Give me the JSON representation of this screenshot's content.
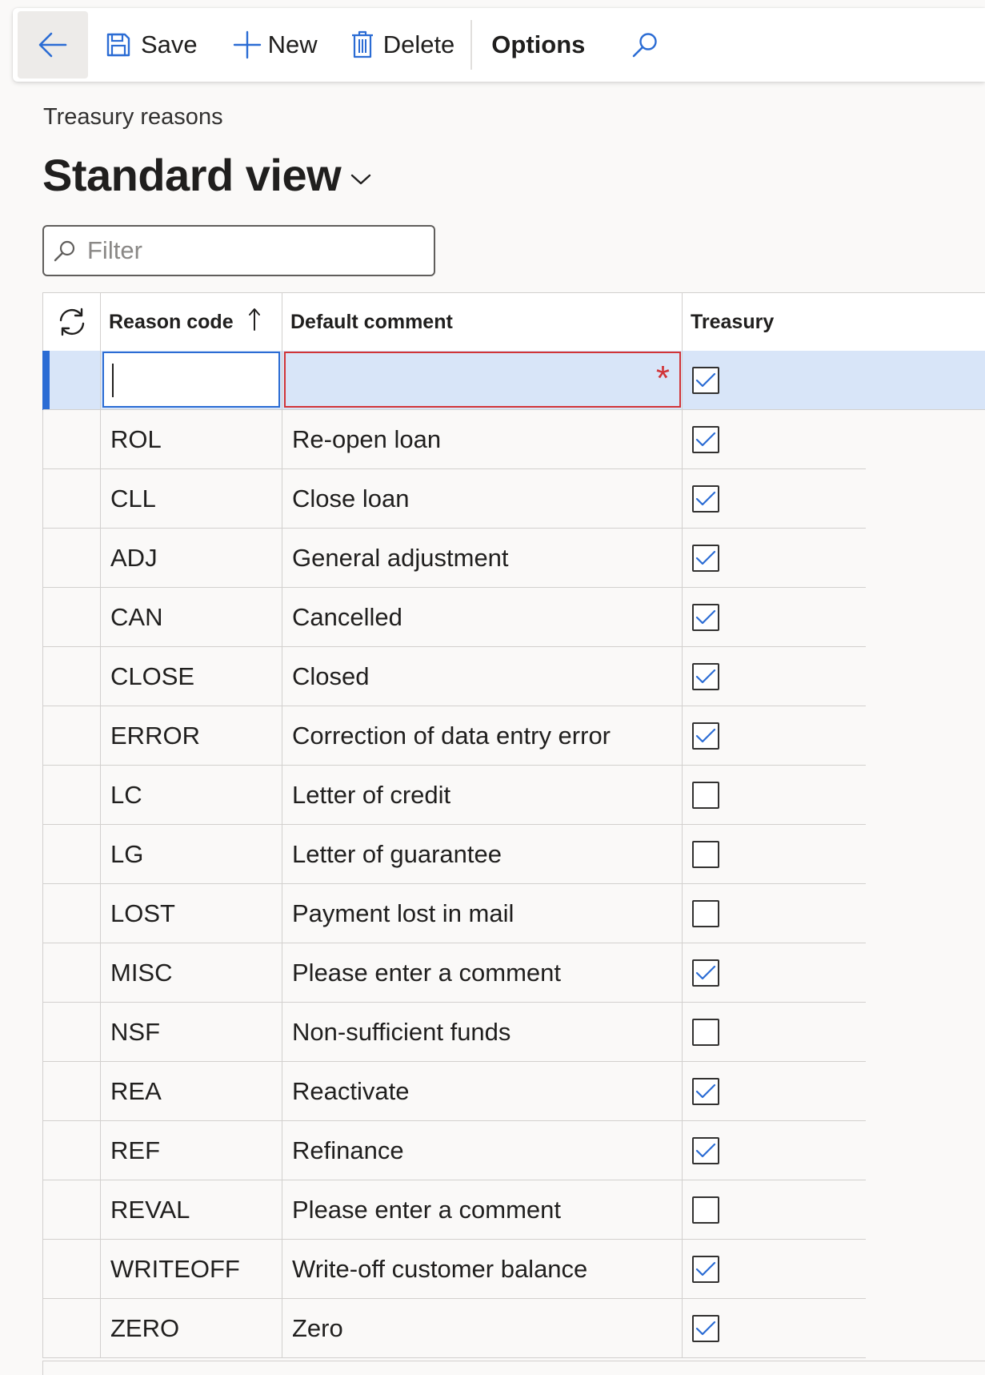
{
  "toolbar": {
    "save_label": "Save",
    "new_label": "New",
    "delete_label": "Delete",
    "options_label": "Options"
  },
  "page": {
    "caption": "Treasury reasons",
    "view_title": "Standard view"
  },
  "filter": {
    "placeholder": "Filter",
    "value": ""
  },
  "grid": {
    "columns": [
      "Reason code",
      "Default comment",
      "Treasury"
    ],
    "sort": {
      "column": "Reason code",
      "direction": "ascending"
    },
    "new_row": {
      "reason_code": "",
      "default_comment": "",
      "treasury": true,
      "comment_required_marker": "*"
    },
    "rows": [
      {
        "reason_code": "ROL",
        "default_comment": "Re-open loan",
        "treasury": true
      },
      {
        "reason_code": "CLL",
        "default_comment": "Close loan",
        "treasury": true
      },
      {
        "reason_code": "ADJ",
        "default_comment": "General adjustment",
        "treasury": true
      },
      {
        "reason_code": "CAN",
        "default_comment": "Cancelled",
        "treasury": true
      },
      {
        "reason_code": "CLOSE",
        "default_comment": "Closed",
        "treasury": true
      },
      {
        "reason_code": "ERROR",
        "default_comment": "Correction of data entry error",
        "treasury": true
      },
      {
        "reason_code": "LC",
        "default_comment": "Letter of credit",
        "treasury": false
      },
      {
        "reason_code": "LG",
        "default_comment": "Letter of guarantee",
        "treasury": false
      },
      {
        "reason_code": "LOST",
        "default_comment": "Payment lost in mail",
        "treasury": false
      },
      {
        "reason_code": "MISC",
        "default_comment": "Please enter a comment",
        "treasury": true
      },
      {
        "reason_code": "NSF",
        "default_comment": "Non-sufficient funds",
        "treasury": false
      },
      {
        "reason_code": "REA",
        "default_comment": "Reactivate",
        "treasury": true
      },
      {
        "reason_code": "REF",
        "default_comment": "Refinance",
        "treasury": true
      },
      {
        "reason_code": "REVAL",
        "default_comment": "Please enter a comment",
        "treasury": false
      },
      {
        "reason_code": "WRITEOFF",
        "default_comment": "Write-off customer balance",
        "treasury": true
      },
      {
        "reason_code": "ZERO",
        "default_comment": "Zero",
        "treasury": true
      }
    ]
  },
  "colors": {
    "accent": "#2b6cd4",
    "selected_row": "#d8e5f8",
    "error": "#d13438"
  },
  "icons": {
    "back": "arrow-left-icon",
    "save": "save-icon",
    "new": "plus-icon",
    "delete": "trash-icon",
    "search": "search-icon",
    "view_dropdown": "chevron-down-icon",
    "filter": "search-icon",
    "refresh": "refresh-icon",
    "sort": "arrow-up-icon",
    "check": "check-icon"
  }
}
